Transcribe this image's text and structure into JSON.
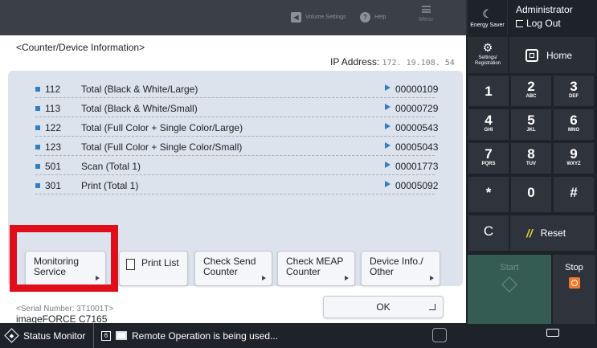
{
  "topbar": {
    "volume_settings": "Volume Settings",
    "help": "Help",
    "menu": "Menu",
    "energy_saver": "Energy Saver"
  },
  "account": {
    "user": "Administrator",
    "logout": "Log Out"
  },
  "page": {
    "title": "<Counter/Device Information>",
    "ip_label": "IP Address:",
    "ip_value": "172. 19.108. 54"
  },
  "counters": [
    {
      "id": "112",
      "name": "Total (Black & White/Large)",
      "value": "00000109"
    },
    {
      "id": "113",
      "name": "Total (Black & White/Small)",
      "value": "00000729"
    },
    {
      "id": "122",
      "name": "Total (Full Color + Single Color/Large)",
      "value": "00000543"
    },
    {
      "id": "123",
      "name": "Total (Full Color + Single Color/Small)",
      "value": "00005043"
    },
    {
      "id": "501",
      "name": "Scan (Total 1)",
      "value": "00001773"
    },
    {
      "id": "301",
      "name": "Print (Total 1)",
      "value": "00005092"
    }
  ],
  "buttons": {
    "monitoring_l1": "Monitoring",
    "monitoring_l2": "Service",
    "print_list": "Print List",
    "check_send_l1": "Check Send",
    "check_send_l2": "Counter",
    "check_meap_l1": "Check MEAP",
    "check_meap_l2": "Counter",
    "device_info_l1": "Device Info./",
    "device_info_l2": "Other",
    "ok": "OK"
  },
  "device": {
    "serial_label": "<Serial Number: 3T1001T>",
    "model": "imageFORCE C7165"
  },
  "statusbar": {
    "status_monitor": "Status Monitor",
    "remote_text": "Remote Operation is being used..."
  },
  "panel": {
    "settings_l1": "Settings/",
    "settings_l2": "Registration",
    "home": "Home",
    "reset": "Reset",
    "start": "Start",
    "stop": "Stop"
  },
  "keypad": [
    {
      "digit": "1",
      "letters": ""
    },
    {
      "digit": "2",
      "letters": "ABC"
    },
    {
      "digit": "3",
      "letters": "DEF"
    },
    {
      "digit": "4",
      "letters": "GHI"
    },
    {
      "digit": "5",
      "letters": "JKL"
    },
    {
      "digit": "6",
      "letters": "MNO"
    },
    {
      "digit": "7",
      "letters": "PQRS"
    },
    {
      "digit": "8",
      "letters": "TUV"
    },
    {
      "digit": "9",
      "letters": "WXYZ"
    },
    {
      "digit": "*",
      "letters": ""
    },
    {
      "digit": "0",
      "letters": ""
    },
    {
      "digit": "#",
      "letters": ""
    },
    {
      "digit": "C",
      "letters": ""
    }
  ],
  "colors": {
    "highlight": "#e00d1a",
    "accent_blue": "#2f7fc4",
    "start_green": "#355c52",
    "stop_orange": "#f07a2c"
  }
}
